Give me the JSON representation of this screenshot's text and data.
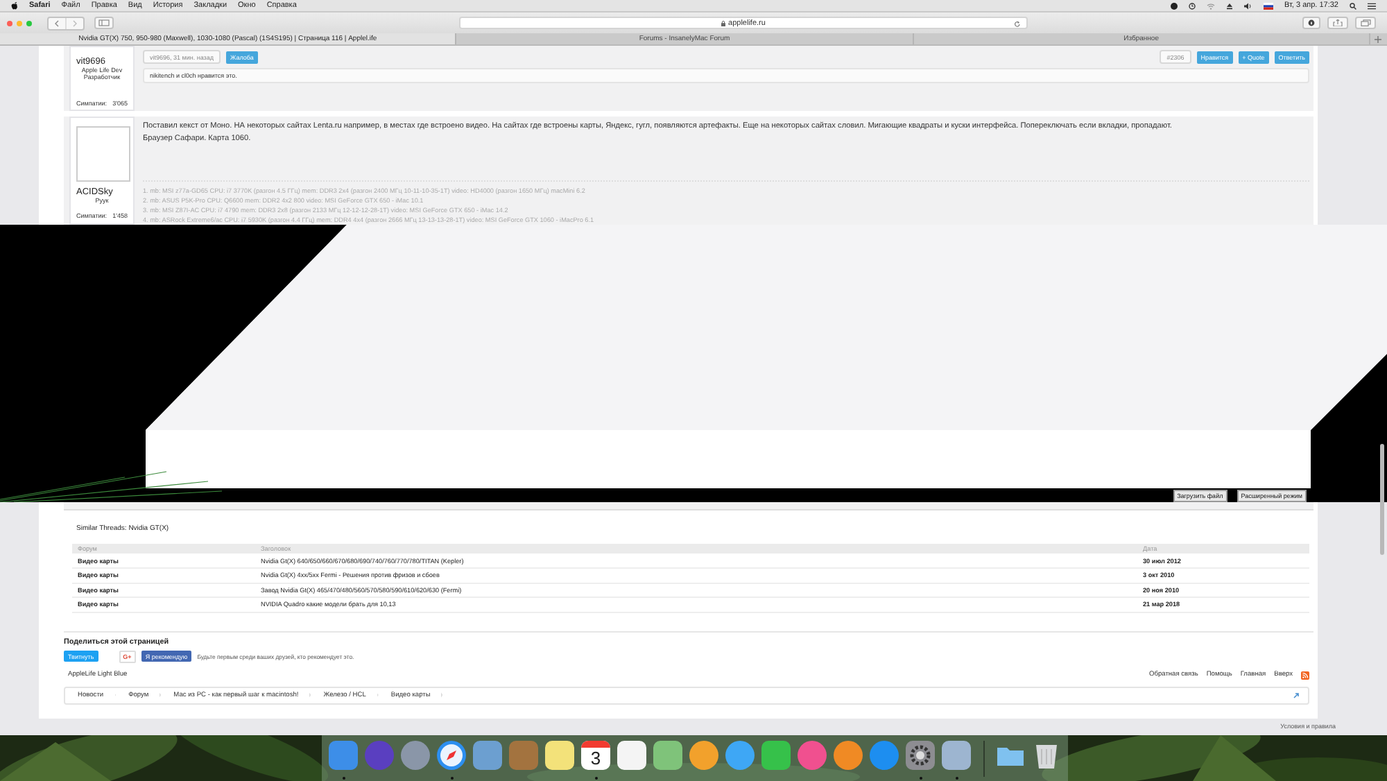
{
  "menu_bar": {
    "app": "Safari",
    "items": [
      "Файл",
      "Правка",
      "Вид",
      "История",
      "Закладки",
      "Окно",
      "Справка"
    ],
    "clock": "Вт, 3 апр. 17:32"
  },
  "toolbar": {
    "address": "applelife.ru"
  },
  "tabs": [
    {
      "label": "Nvidia GT(X) 750, 950-980 (Maxwell), 1030-1080 (Pascal) (1S4S195) | Страница 116 | Applel.ife",
      "selected": true
    },
    {
      "label": "Forums - InsanelyMac Forum",
      "selected": false
    },
    {
      "label": "Избранное",
      "selected": false
    }
  ],
  "posts": [
    {
      "author": "vit9696",
      "titles": [
        "Apple Life Dev",
        "Разработчик"
      ],
      "likes_label": "Симпатии:",
      "likes": "3'065",
      "meta": "vit9696, 31 мин. назад",
      "report": "Жалоба",
      "number": "#2306",
      "actions": [
        "Нравится",
        "+ Quote",
        "Ответить"
      ],
      "liked_by": "nikitench и cl0ch нравится это."
    },
    {
      "author": "ACIDSky",
      "titles": [
        "Руук"
      ],
      "likes_label": "Симпатии:",
      "likes": "1'458",
      "message": [
        "Поставил кекст от Моно. НА некоторых сайтах Lenta.ru например, в местах где встроено видео. На сайтах где встроены карты, Яндекс, гугл, появляются артефакты. Еще на некоторых сайтах словил. Мигающие квадраты и куски интерфейса. Попереключать если вкладки, пропадают.",
        "Браузер Сафари. Карта 1060."
      ],
      "signature": [
        "1. mb: MSI z77a-GD65 CPU: i7 3770K (разгон 4.5 ГГц) mem: DDR3 2x4 (разгон 2400 МГц 10-11-10-35-1T) video: HD4000 (разгон 1650 МГц) macMini 6.2",
        "2. mb: ASUS P5K-Pro CPU: Q6600 mem: DDR2 4x2 800 video: MSI GeForce GTX 650 - iMac 10.1",
        "3. mb: MSI Z87I-AC CPU: i7 4790 mem: DDR3 2x8 (разгон 2133 МГц 12-12-12-28-1T) video: MSI GeForce GTX 650 - iMac 14.2",
        "4. mb: ASRock Extreme6/ac CPU: i7 5930K (разгон 4.4 ГГц) mem: DDR4 4x4 (разгон 2666 МГц 13-13-13-28-1T) video: MSI GeForce GTX 1060 - iMacPro 6.1"
      ]
    }
  ],
  "editor_buttons": [
    "Загрузить файл",
    "Расширенный режим"
  ],
  "similar_threads": {
    "title": "Similar Threads: Nvidia GT(X)",
    "columns": [
      "Форум",
      "Заголовок",
      "Дата"
    ],
    "rows": [
      [
        "Видео карты",
        "Nvidia Gt(X) 640/650/660/670/680/690/740/760/770/780/TITAN (Kepler)",
        "30 июл 2012"
      ],
      [
        "Видео карты",
        "Nvidia Gt(X) 4xx/5xx Fermi - Решения против фризов и сбоев",
        "3 окт 2010"
      ],
      [
        "Видео карты",
        "Завод Nvidia Gt(X) 465/470/480/560/570/580/590/610/620/630 (Fermi)",
        "20 ноя 2010"
      ],
      [
        "Видео карты",
        "NVIDIA Quadro какие модели брать для 10,13",
        "21 мар 2018"
      ]
    ]
  },
  "share": {
    "title": "Поделиться этой страницей",
    "tweet": "Твитнуть",
    "gplus": "G+",
    "recommend": "Я рекомендую",
    "note": "Будьте первым среди ваших друзей, кто рекомендует это."
  },
  "footer": {
    "style": "AppleLife Light Blue",
    "links": [
      "Обратная связь",
      "Помощь",
      "Главная",
      "Вверх"
    ]
  },
  "breadcrumb": [
    "Новости",
    "Форум",
    "Мас из PC - как первый шаг к macintosh!",
    "Железо / HCL",
    "Видео карты"
  ],
  "terms": "Условия и правила",
  "dock": [
    {
      "kind": "tile",
      "color": "#3d8ee8",
      "running": true
    },
    {
      "kind": "round",
      "color": "#5a3fc0",
      "running": false
    },
    {
      "kind": "round",
      "color": "#8a96a8",
      "running": false
    },
    {
      "kind": "compass",
      "color": "#2c8ff0",
      "running": true
    },
    {
      "kind": "tile",
      "color": "#6c9fd0",
      "running": false
    },
    {
      "kind": "tile",
      "color": "#a3733f",
      "running": false
    },
    {
      "kind": "tile",
      "color": "#f3e27a",
      "running": false
    },
    {
      "kind": "calendar",
      "color": "#ffffff",
      "date": "3",
      "running": true
    },
    {
      "kind": "tile",
      "color": "#f4f4f4",
      "running": false
    },
    {
      "kind": "tile",
      "color": "#7fc37a",
      "running": false
    },
    {
      "kind": "round",
      "color": "#f2a12c",
      "running": false
    },
    {
      "kind": "round",
      "color": "#3ea7f5",
      "running": false
    },
    {
      "kind": "tile",
      "color": "#36c14a",
      "running": false
    },
    {
      "kind": "round",
      "color": "#f0508f",
      "running": false
    },
    {
      "kind": "round",
      "color": "#f08a24",
      "running": false
    },
    {
      "kind": "round",
      "color": "#1d8ef0",
      "running": false
    },
    {
      "kind": "gear",
      "color": "#8d8d92",
      "running": true
    },
    {
      "kind": "tile",
      "color": "#9db5d0",
      "running": true
    },
    {
      "kind": "folder",
      "color": "#7fc1ef",
      "running": false
    },
    {
      "kind": "trash",
      "color": "#d8dadc",
      "running": false
    }
  ]
}
